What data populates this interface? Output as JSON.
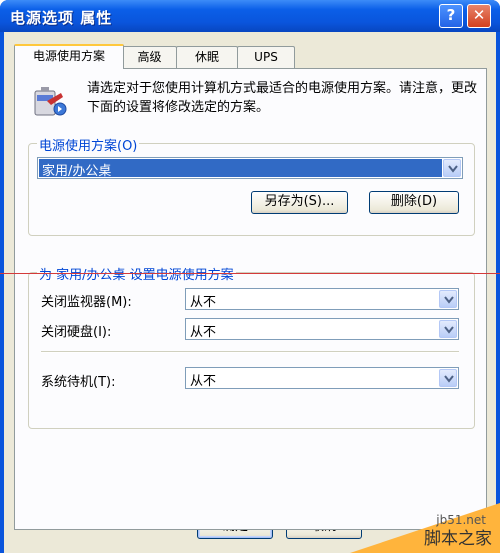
{
  "window": {
    "title": "电源选项 属性",
    "help_label": "?",
    "close_label": "✕"
  },
  "tabs": [
    {
      "label": "电源使用方案",
      "active": true
    },
    {
      "label": "高级",
      "active": false
    },
    {
      "label": "休眠",
      "active": false
    },
    {
      "label": "UPS",
      "active": false
    }
  ],
  "intro": {
    "icon": "power-battery-icon",
    "text": "请选定对于您使用计算机方式最适合的电源使用方案。请注意，更改下面的设置将修改选定的方案。"
  },
  "scheme_group": {
    "title": "电源使用方案(O)",
    "selected": "家用/办公桌",
    "save_as_label": "另存为(S)...",
    "delete_label": "删除(D)"
  },
  "settings_group": {
    "title": "为 家用/办公桌 设置电源使用方案",
    "monitor_label": "关闭监视器(M):",
    "monitor_value": "从不",
    "harddisk_label": "关闭硬盘(I):",
    "harddisk_value": "从不",
    "standby_label": "系统待机(T):",
    "standby_value": "从不"
  },
  "footer": {
    "ok_label": "确定",
    "cancel_label": "取消"
  },
  "watermark": {
    "site": "jb51.net",
    "name": "脚本之家"
  },
  "colors": {
    "titlebar": "#0a55dc",
    "face": "#ece9d8",
    "group_title": "#0046d5",
    "selection": "#316ac5",
    "accent_tab": "#ffc83c",
    "watermark": "#ffb43c"
  }
}
